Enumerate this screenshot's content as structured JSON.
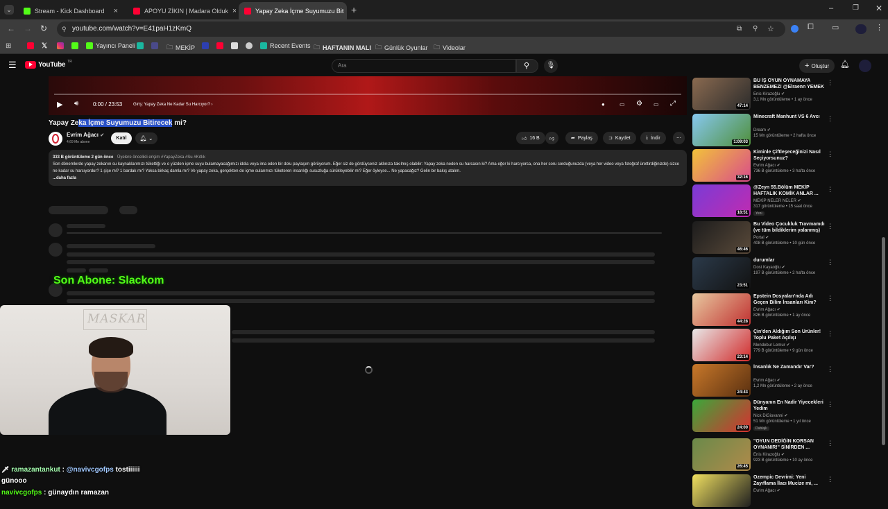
{
  "browser": {
    "tabs": [
      {
        "title": "Stream - Kick Dashboard",
        "color": "#53fc18"
      },
      {
        "title": "APOYU ZİKIN | Madara Olduk",
        "color": "#ff0033"
      },
      {
        "title": "Yapay Zeka İçme Suyumuzu Bit",
        "color": "#ff0033"
      }
    ],
    "new_tab": "+",
    "url": "youtube.com/watch?v=E41paH1zKmQ",
    "bookmarks": [
      "Yayıncı Paneli",
      "MEKİP",
      "Recent Events",
      "HAFTANIN MALI",
      "Günlük Oyunlar",
      "Videolar"
    ]
  },
  "youtube": {
    "logo": "YouTube",
    "logo_sup": "TR",
    "search_placeholder": "Ara",
    "create_label": "Oluştur"
  },
  "player": {
    "time": "0:00 / 23:53",
    "chapter": "Giriş: Yapay Zeka Ne Kadar Su Harcıyor?",
    "progress": 0.0
  },
  "video": {
    "title_plain_a": "Yapay Ze",
    "title_selected": "ka İçme Suyumuzu Bitirecek",
    "title_plain_b": " mi?",
    "channel": "Evrim Ağacı",
    "subscribers": "4,69 Mn abone",
    "join_label": "Katıl",
    "likes": "16 B",
    "share_label": "Paylaş",
    "save_label": "Kaydet",
    "download_label": "İndir",
    "views_date": "333 B görüntüleme  2 gün önce",
    "tags": "Üyelere öncelikli erişim  #YapayZeka #Su #Kıtlık",
    "description": "Son dönemlerde yapay zekanın su kaynaklarımızı tükettiği ve o yüzden içme suyu bulamayacağımızı iddia veya ima eden bir dolu paylaşım görüyorum. Eğer siz de gördüyseniz aklınıza takılmış olabilir: Yapay zeka neden su harcasın ki? Ama eğer ki harcıyorsa, ona her soru sorduğunuzda (veya her video veya fotoğraf ürettirdiğinizde) sizce ne kadar su harcıyordur? 1 şişe mi? 1 bardak mı? Yoksa birkaç damla mı? Ve yapay zeka, gerçekten de içme sularımızı tüketeren insanlığı susuzluğa sürükleyebilir mi? Eğer öyleyse... Ne yapacağız? Gelin bir bakış atalım.",
    "more_label": "...daha fazla"
  },
  "overlay": {
    "last_sub": "Son Abone: Slackom",
    "webcam_label": "MASKAR"
  },
  "chat": [
    {
      "user": "ramazantankut",
      "text": " : ",
      "mention": "@navivcgofps",
      "rest": " tostiiiiii",
      "user_color": "#a6ffb0"
    },
    {
      "user": "",
      "text": "günooo",
      "mention": "",
      "rest": "",
      "user_color": "#ffffff"
    },
    {
      "user": "navivcgofps",
      "text": " : günaydın ramazan",
      "mention": "",
      "rest": "",
      "user_color": "#53fc18"
    }
  ],
  "recommendations": [
    {
      "title": "BU İŞ OYUN OYNAMAYA BENZEMEZ! @Elraenn YEMEK ...",
      "channel": "Enis Kirazoğlu",
      "meta": "3,1 Mn görüntüleme  •  1 ay önce",
      "duration": "47:14",
      "c1": "#8a6a50",
      "c2": "#2b2b2b"
    },
    {
      "title": "Minecraft Manhunt VS 6 Avcı",
      "channel": "Dream",
      "meta": "15 Mn görüntüleme  •  2 hafta önce",
      "duration": "1:09:03",
      "c1": "#87c8f0",
      "c2": "#4f8f3a"
    },
    {
      "title": "Kiminle Çiftleşeceğinizi Nasıl Seçiyorsunuz?",
      "channel": "Evrim Ağacı",
      "meta": "736 B görüntüleme  •  3 hafta önce",
      "duration": "32:16",
      "c1": "#f2c23a",
      "c2": "#d94c8a"
    },
    {
      "title": "@Zeyn 55.Bölüm MEKİP HAFTALIK KOMİK ANLAR ...",
      "channel": "MEKİP NELER NELER",
      "meta": "317 görüntüleme  •  15 saat önce",
      "duration": "18:51",
      "c1": "#7a3bd6",
      "c2": "#c02bb0",
      "badge": "Yeni"
    },
    {
      "title": "Bu Video Çocukluk Travmamdı (ve tüm bildiklerim yalanmış)",
      "channel": "Portal",
      "meta": "408 B görüntüleme  •  10 gün önce",
      "duration": "46:46",
      "c1": "#1c1c1c",
      "c2": "#5a4a3a"
    },
    {
      "title": "durumlar",
      "channel": "Dost Kayaoğlu",
      "meta": "197 B görüntüleme  •  2 hafta önce",
      "duration": "23:51",
      "c1": "#2b3a4a",
      "c2": "#121212"
    },
    {
      "title": "Epstein Dosyaları'nda Adı Geçen Bilim İnsanları Kim?",
      "channel": "Evrim Ağacı",
      "meta": "826 B görüntüleme  •  1 ay önce",
      "duration": "44:28",
      "c1": "#e8c9a0",
      "c2": "#c03030"
    },
    {
      "title": "Çin'den Aldığım Son Ürünler! Toplu Paket Açılışı",
      "channel": "Mendebur Lemur",
      "meta": "779 B görüntüleme  •  9 gün önce",
      "duration": "23:14",
      "c1": "#e8e8e8",
      "c2": "#d12a2a"
    },
    {
      "title": "İnsanlık Ne Zamandır Var?",
      "channel": "Evrim Ağacı",
      "meta": "1,2 Mn görüntüleme  •  2 ay önce",
      "duration": "24:43",
      "c1": "#c8782a",
      "c2": "#5a3010"
    },
    {
      "title": "Dünyanın En Nadir Yiyecekleri Yedim",
      "channel": "Nick DiGiovanni",
      "meta": "51 Mn görüntüleme  •  1 yıl önce",
      "duration": "24:00",
      "c1": "#3aa83a",
      "c2": "#d83030",
      "badge": "Dublajlı"
    },
    {
      "title": "\"OYUN DEDİĞİN KORSAN OYNANIR!\" SİNİRDEN ...",
      "channel": "Enis Kirazoğlu",
      "meta": "923 B görüntüleme  •  10 ay önce",
      "duration": "26:45",
      "c1": "#6a8a4a",
      "c2": "#b08a4a"
    },
    {
      "title": "Ozempic Devrimi: Yeni Zayıflama İlacı Mucize mi, ...",
      "channel": "Evrim Ağacı",
      "meta": "",
      "duration": "",
      "c1": "#f0e060",
      "c2": "#202020"
    }
  ]
}
